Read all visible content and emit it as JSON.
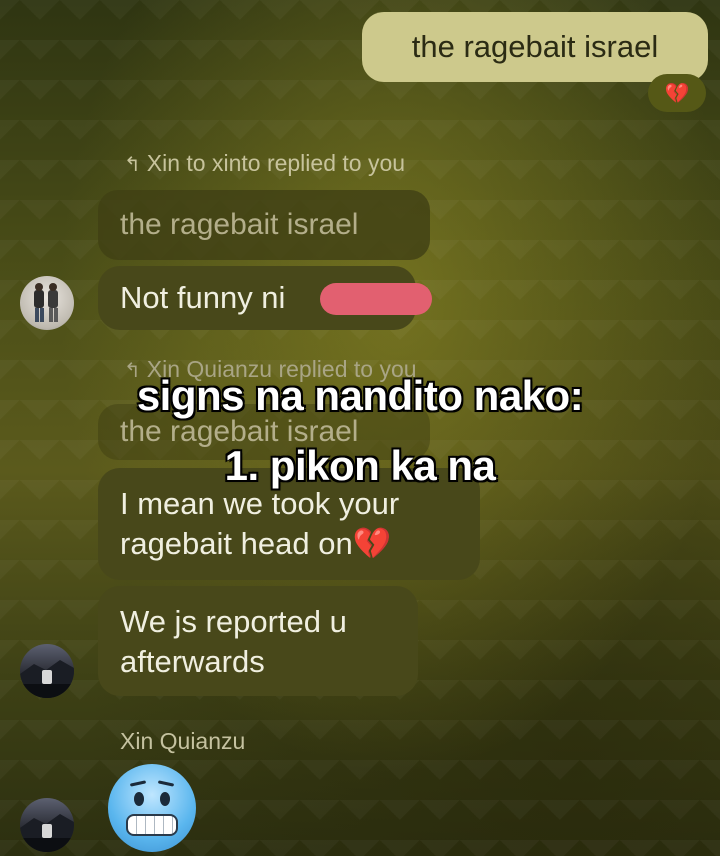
{
  "outgoing": {
    "text": "the ragebait israel",
    "reaction": "💔"
  },
  "reply1": {
    "tag": "Xin to xinto replied to you",
    "quoted": "the ragebait israel",
    "message": "Not funny ni"
  },
  "reply2": {
    "tag": "Xin Quianzu replied to you",
    "quoted": "the ragebait israel"
  },
  "messages": {
    "m1_line1": "I mean we took your",
    "m1_line2": "ragebait head on💔",
    "m2_line1": "We js reported u",
    "m2_line2": "afterwards"
  },
  "sender": "Xin Quianzu",
  "overlay": {
    "line1": "signs na nandito nako:",
    "line2": "1. pikon ka na"
  },
  "icons": {
    "reply_arrow": "↰",
    "reply_icon": "reply-arrow-icon",
    "cold_face": "cold-face-emoji-icon"
  },
  "colors": {
    "outgoing_bubble": "#cdc98c",
    "incoming_bubble": "#48481a",
    "redaction": "#e26070"
  }
}
